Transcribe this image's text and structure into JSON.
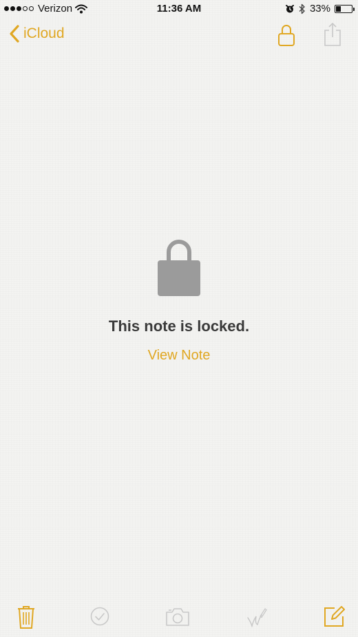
{
  "status_bar": {
    "carrier": "Verizon",
    "time": "11:36 AM",
    "battery_percent": "33%",
    "battery_level": 0.33,
    "signal_bars_filled": 3,
    "signal_bars_total": 5
  },
  "nav": {
    "back_label": "iCloud",
    "lock_icon": "lock-open-icon",
    "share_icon": "share-icon"
  },
  "locked": {
    "title": "This note is locked.",
    "action_label": "View Note"
  },
  "toolbar": {
    "icons": [
      "trash-icon",
      "checklist-icon",
      "camera-icon",
      "sketch-icon",
      "compose-icon"
    ]
  },
  "colors": {
    "accent": "#e0a722",
    "disabled": "#c8c8c8",
    "lock_gray": "#9b9b9b",
    "background": "#f3f3f1"
  }
}
